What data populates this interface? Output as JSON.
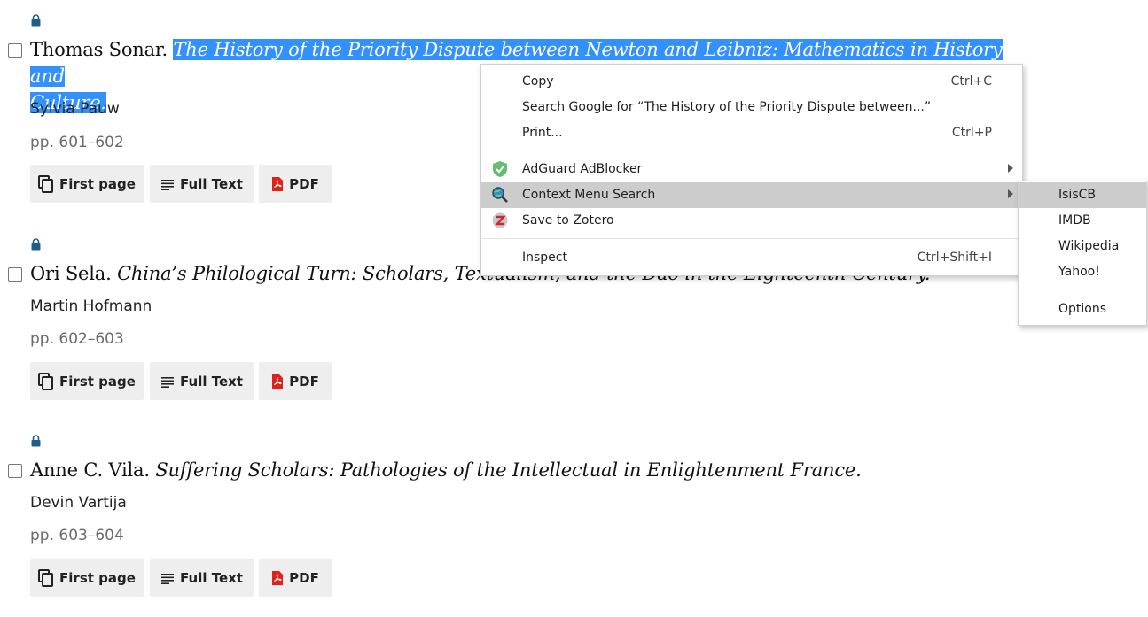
{
  "entries": [
    {
      "author": "Thomas Sonar.",
      "title_line1": "The History of the Priority Dispute between Newton and Leibniz: Mathematics in History and",
      "title_line2": "Culture",
      "reviewer": "Sylvia Pauw",
      "pages": "pp. 601–602"
    },
    {
      "author": "Ori Sela.",
      "title": "China’s Philological Turn: Scholars, Textualism, and the Dao in the Eighteenth Century",
      "reviewer": "Martin Hofmann",
      "pages": "pp. 602–603"
    },
    {
      "author": "Anne C. Vila.",
      "title": "Suffering Scholars: Pathologies of the Intellectual in Enlightenment France",
      "reviewer": "Devin Vartija",
      "pages": "pp. 603–604"
    }
  ],
  "buttons": {
    "first_page": "First page",
    "full_text": "Full Text",
    "pdf": "PDF"
  },
  "context_menu": {
    "copy": "Copy",
    "copy_shortcut": "Ctrl+C",
    "search_google": "Search Google for “The History of the Priority Dispute between...”",
    "print": "Print...",
    "print_shortcut": "Ctrl+P",
    "adguard": "AdGuard AdBlocker",
    "context_menu_search": "Context Menu Search",
    "zotero": "Save to Zotero",
    "inspect": "Inspect",
    "inspect_shortcut": "Ctrl+Shift+I"
  },
  "submenu": {
    "items": [
      "IsisCB",
      "IMDB",
      "Wikipedia",
      "Yahoo!"
    ],
    "options": "Options"
  },
  "colors": {
    "selection": "#3390ff",
    "lock": "#1f5f86",
    "pdf_icon": "#e0201b",
    "menu_highlight": "#cccccc"
  }
}
